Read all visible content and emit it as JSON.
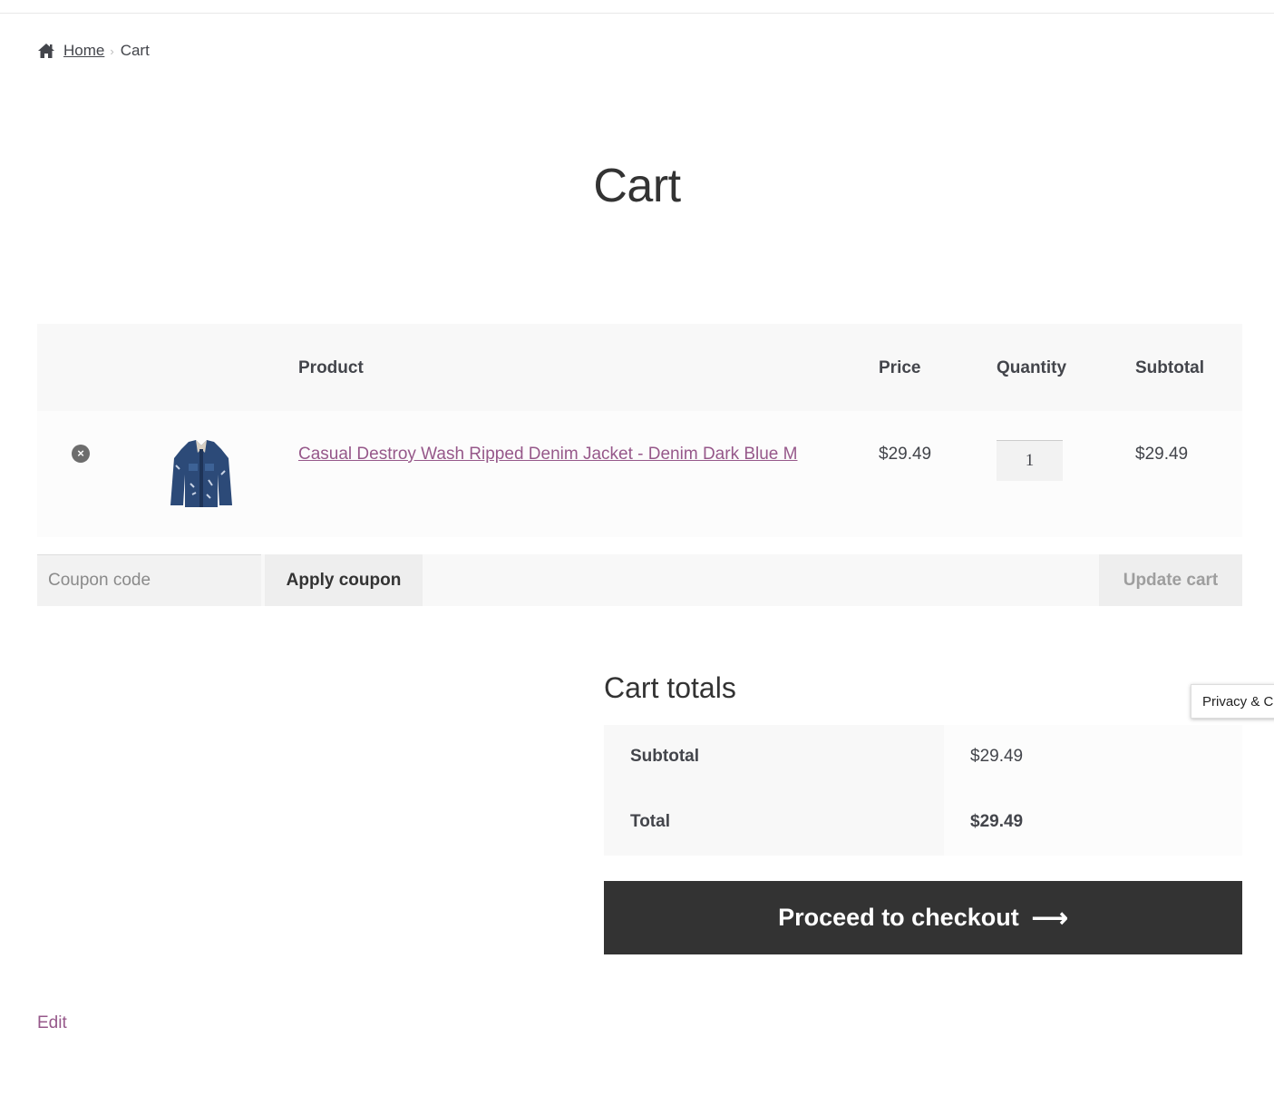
{
  "breadcrumb": {
    "home": "Home",
    "separator": "›",
    "current": "Cart"
  },
  "page": {
    "title": "Cart"
  },
  "cart_table": {
    "headers": {
      "product": "Product",
      "price": "Price",
      "quantity": "Quantity",
      "subtotal": "Subtotal"
    },
    "items": [
      {
        "remove_icon": "×",
        "name": "Casual Destroy Wash Ripped Denim Jacket - Denim Dark Blue M",
        "price": "$29.49",
        "quantity": "1",
        "subtotal": "$29.49"
      }
    ]
  },
  "coupon": {
    "placeholder": "Coupon code",
    "apply_label": "Apply coupon"
  },
  "update_cart_label": "Update cart",
  "totals": {
    "title": "Cart totals",
    "subtotal_label": "Subtotal",
    "subtotal_value": "$29.49",
    "total_label": "Total",
    "total_value": "$29.49"
  },
  "checkout": {
    "label": "Proceed to checkout",
    "arrow": "⟶"
  },
  "edit_label": "Edit",
  "privacy_tab": "Privacy & Cookies",
  "colors": {
    "link": "#96588a",
    "checkout_bg": "#333333"
  }
}
